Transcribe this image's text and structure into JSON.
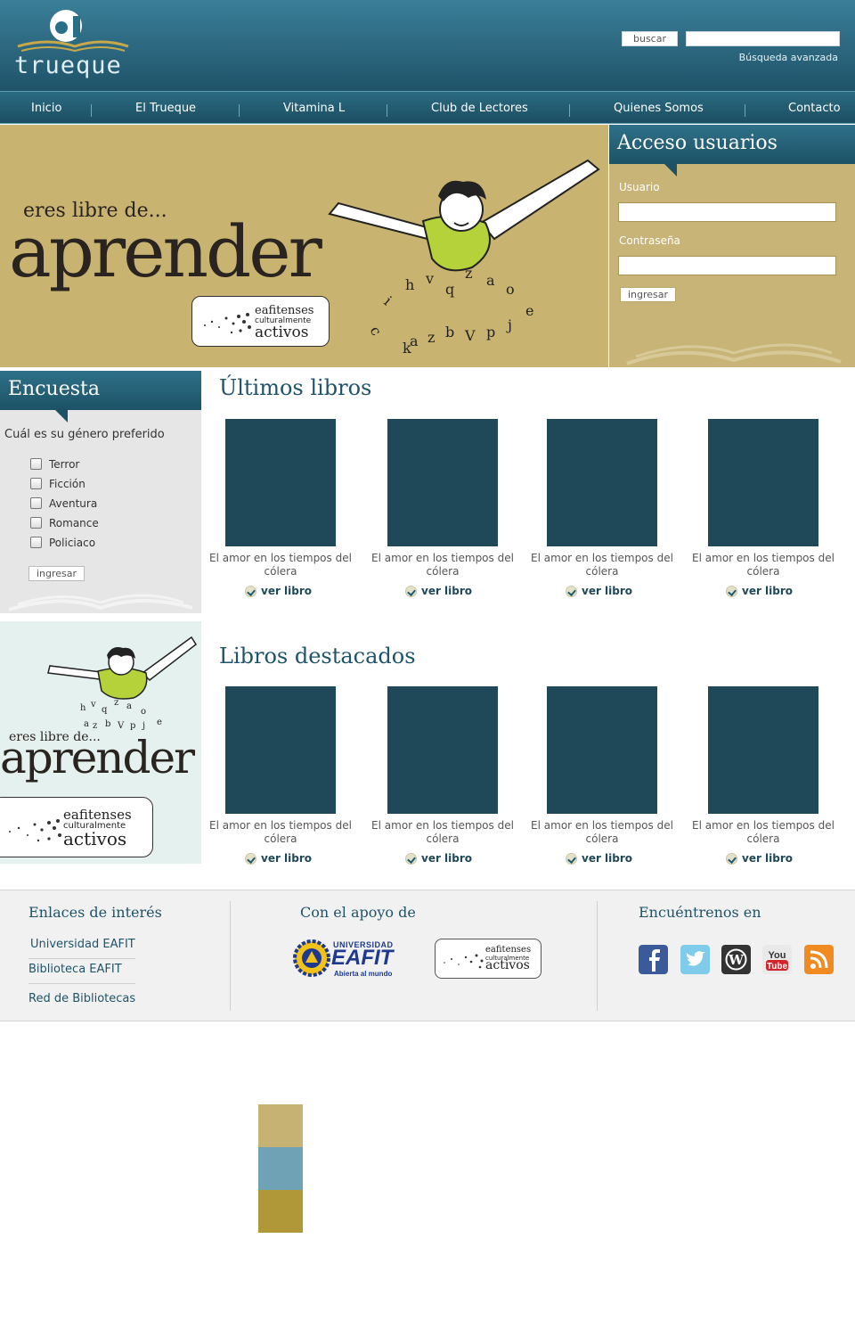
{
  "header": {
    "logo_text": "trueque",
    "search_button": "buscar",
    "search_placeholder": "",
    "advanced_search": "Búsqueda avanzada"
  },
  "nav": [
    "Inicio",
    "El Trueque",
    "Vitamina L",
    "Club de Lectores",
    "Quienes Somos",
    "Contacto"
  ],
  "hero": {
    "line1": "eres libre de...",
    "line2": "aprender",
    "badge": [
      "eafitenses",
      "culturalmente",
      "activos"
    ]
  },
  "login": {
    "title": "Acceso usuarios",
    "user_label": "Usuario",
    "password_label": "Contraseña",
    "submit": "ingresar"
  },
  "poll": {
    "title": "Encuesta",
    "question": "Cuál es su género preferido",
    "options": [
      "Terror",
      "Ficción",
      "Aventura",
      "Romance",
      "Policiaco"
    ],
    "submit": "ingresar"
  },
  "side_banner": {
    "line1": "eres libre de...",
    "line2": "aprender",
    "badge": [
      "eafitenses",
      "culturalmente",
      "activos"
    ]
  },
  "latest": {
    "title": "Últimos libros",
    "books": [
      {
        "title": "El amor en los tiempos del cólera",
        "link": "ver libro"
      },
      {
        "title": "El amor en los tiempos del cólera",
        "link": "ver libro"
      },
      {
        "title": "El amor en los tiempos del cólera",
        "link": "ver libro"
      },
      {
        "title": "El amor en los tiempos del cólera",
        "link": "ver libro"
      }
    ]
  },
  "featured": {
    "title": "Libros destacados",
    "books": [
      {
        "title": "El amor en los tiempos del cólera",
        "link": "ver libro"
      },
      {
        "title": "El amor en los tiempos del cólera",
        "link": "ver libro"
      },
      {
        "title": "El amor en los tiempos del cólera",
        "link": "ver libro"
      },
      {
        "title": "El amor en los tiempos del cólera",
        "link": "ver libro"
      }
    ]
  },
  "footer": {
    "links_title": "Enlaces de interés",
    "links": [
      "Universidad EAFIT",
      "Biblioteca EAFIT",
      "Red de Bibliotecas"
    ],
    "support_title": "Con el apoyo de",
    "eafit_small": "UNIVERSIDAD",
    "eafit_big": "EAFIT",
    "eafit_tagline": "Abierta al mundo",
    "partner_badge": [
      "eafitenses",
      "culturalmente",
      "activos"
    ],
    "social_title": "Encuéntrenos en",
    "social": [
      "facebook-icon",
      "twitter-icon",
      "wordpress-icon",
      "youtube-icon",
      "rss-icon"
    ]
  },
  "colors": {
    "primary": "#1f5369",
    "sand": "#c8b470",
    "cover": "#1f4958",
    "palette": [
      "#c6b373",
      "#6fa2b4",
      "#b09838"
    ]
  }
}
